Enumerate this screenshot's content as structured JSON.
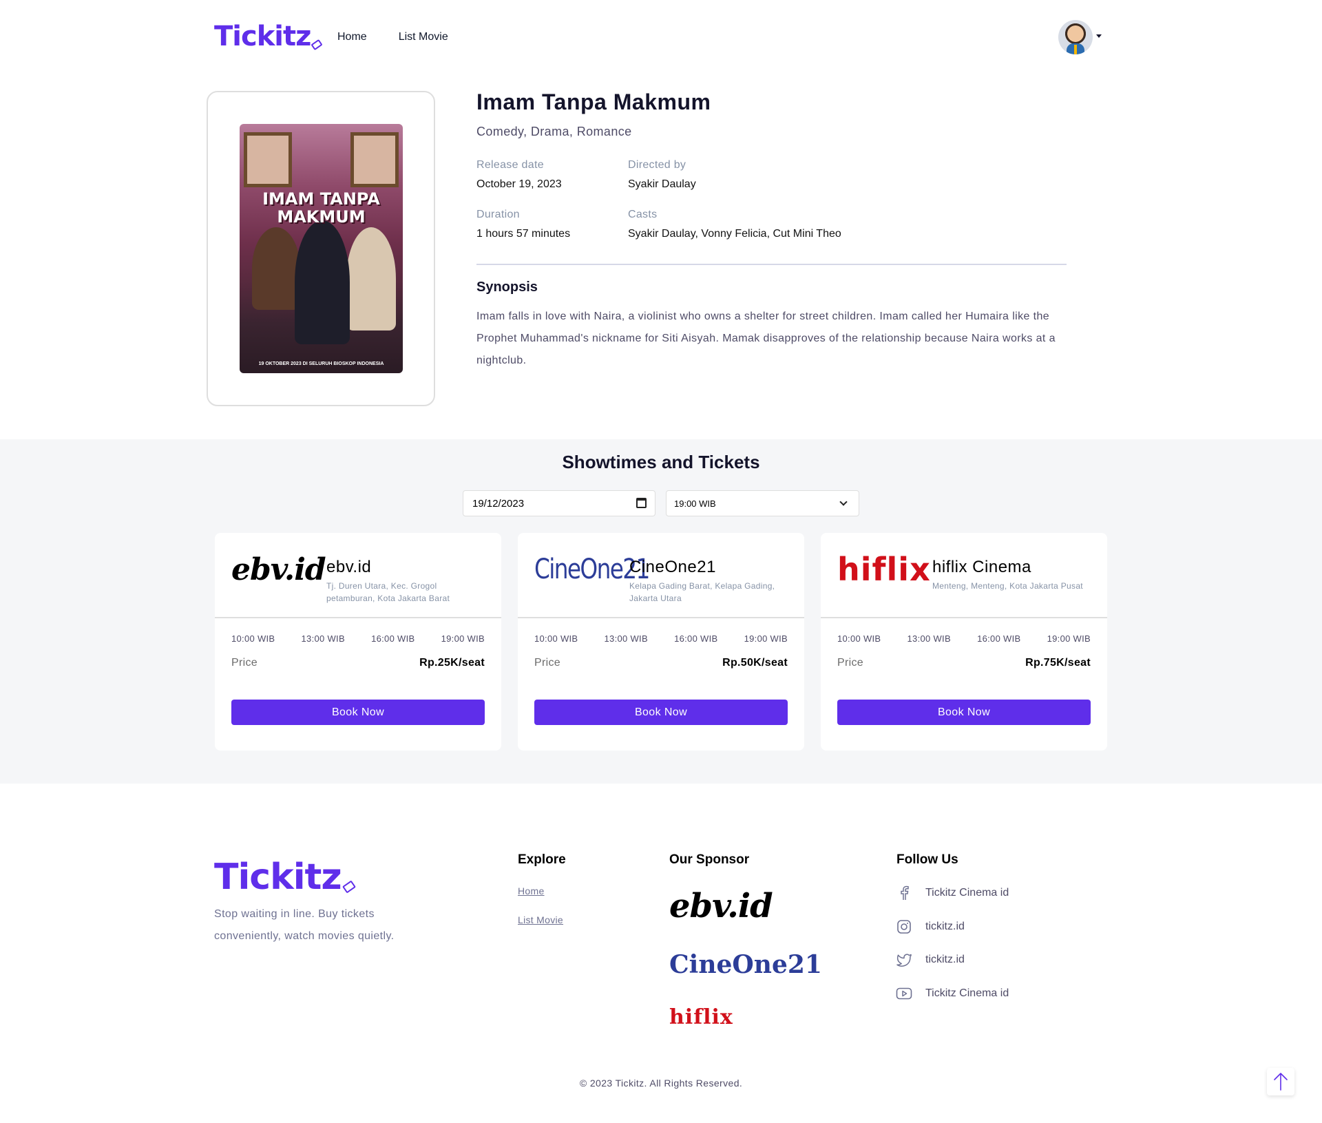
{
  "header": {
    "logo": "Tickitz",
    "nav": [
      "Home",
      "List Movie"
    ]
  },
  "movie": {
    "poster": {
      "title_line1": "IMAM TANPA",
      "title_line2": "MAKMUM",
      "bottom_text": "19 OKTOBER 2023 DI SELURUH BIOSKOP INDONESIA"
    },
    "title": "Imam Tanpa Makmum",
    "genres": "Comedy, Drama, Romance",
    "release_label": "Release date",
    "release_value": "October 19, 2023",
    "director_label": "Directed by",
    "director_value": "Syakir Daulay",
    "duration_label": "Duration",
    "duration_value": "1 hours 57 minutes",
    "casts_label": "Casts",
    "casts_value": "Syakir Daulay, Vonny Felicia, Cut Mini Theo",
    "synopsis_heading": "Synopsis",
    "synopsis": "Imam falls in love with Naira, a violinist who owns a shelter for street children. Imam called her Humaira like the Prophet Muhammad's nickname for Siti Aisyah. Mamak disapproves of the relationship because Naira works at a nightclub."
  },
  "showtimes": {
    "heading": "Showtimes and Tickets",
    "date_value": "19/12/2023",
    "time_value": "19:00 WIB",
    "price_label": "Price",
    "book_label": "Book Now",
    "cinemas": [
      {
        "logo_text": "ebv.id",
        "name": "ebv.id",
        "address": "Tj. Duren Utara, Kec. Grogol petamburan, Kota Jakarta Barat",
        "times": [
          "10:00 WIB",
          "13:00 WIB",
          "16:00 WIB",
          "19:00 WIB"
        ],
        "price": "Rp.25K/seat"
      },
      {
        "logo_text": "CineOne21",
        "name": "CineOne21",
        "address": "Kelapa Gading Barat, Kelapa Gading, Jakarta Utara",
        "times": [
          "10:00 WIB",
          "13:00 WIB",
          "16:00 WIB",
          "19:00 WIB"
        ],
        "price": "Rp.50K/seat"
      },
      {
        "logo_text": "hiflix",
        "name": "hiflix Cinema",
        "address": "Menteng, Menteng, Kota Jakarta Pusat",
        "times": [
          "10:00 WIB",
          "13:00 WIB",
          "16:00 WIB",
          "19:00 WIB"
        ],
        "price": "Rp.75K/seat"
      }
    ]
  },
  "footer": {
    "logo": "Tickitz",
    "tagline": "Stop waiting in line. Buy tickets conveniently, watch movies quietly.",
    "explore_heading": "Explore",
    "explore_links": [
      "Home",
      "List Movie"
    ],
    "sponsor_heading": "Our Sponsor",
    "sponsors": [
      "ebv.id",
      "CineOne21",
      "hiflix"
    ],
    "follow_heading": "Follow Us",
    "socials": [
      {
        "icon": "facebook-icon",
        "label": "Tickitz Cinema id"
      },
      {
        "icon": "instagram-icon",
        "label": "tickitz.id"
      },
      {
        "icon": "twitter-icon",
        "label": "tickitz.id"
      },
      {
        "icon": "youtube-icon",
        "label": "Tickitz Cinema id"
      }
    ],
    "copyright": "© 2023 Tickitz. All Rights Reserved."
  },
  "colors": {
    "brand": "#5f2eea",
    "section_bg": "#f5f6f8",
    "cineone_blue": "#2c3d98",
    "hiflix_red": "#d1101a"
  }
}
